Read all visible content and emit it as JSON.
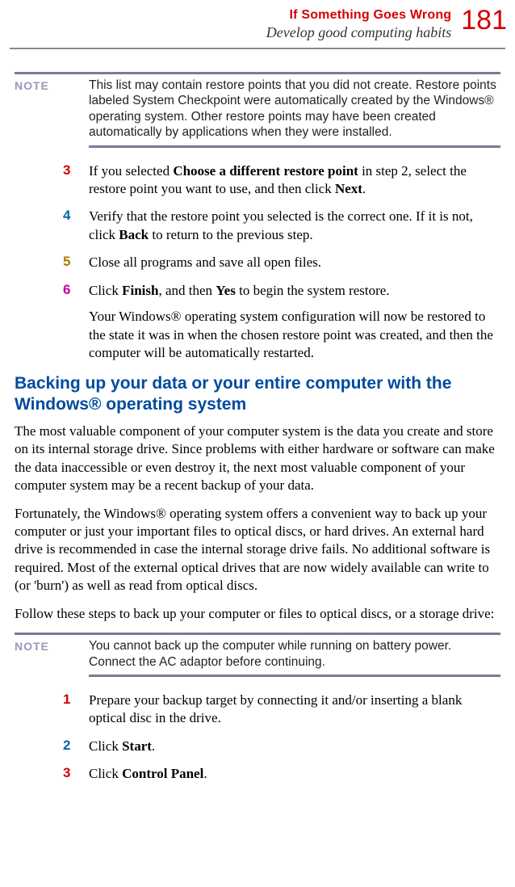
{
  "header": {
    "title": "If Something Goes Wrong",
    "subtitle": "Develop good computing habits",
    "page_number": "181"
  },
  "note1": {
    "label": "NOTE",
    "text": "This list may contain restore points that you did not create. Restore points labeled System Checkpoint were automatically created by the Windows® operating system. Other restore points may have been created automatically by applications when they were installed."
  },
  "steps_a": {
    "s3": {
      "num": "3",
      "pre": "If you selected ",
      "bold1": "Choose a different restore point",
      "mid": " in step 2, select the restore point you want to use, and then click ",
      "bold2": "Next",
      "post": "."
    },
    "s4": {
      "num": "4",
      "pre": "Verify that the restore point you selected is the correct one. If it is not, click ",
      "bold1": "Back",
      "post": " to return to the previous step."
    },
    "s5": {
      "num": "5",
      "text": "Close all programs and save all open files."
    },
    "s6": {
      "num": "6",
      "pre": "Click ",
      "bold1": "Finish",
      "mid": ", and then ",
      "bold2": "Yes",
      "post": " to begin the system restore.",
      "para2": "Your Windows® operating system configuration will now be restored to the state it was in when the chosen restore point was created, and then the computer will be automatically restarted."
    }
  },
  "section": {
    "heading": "Backing up your data or your entire computer with the Windows® operating system",
    "p1": "The most valuable component of your computer system is the data you create and store on its internal storage drive. Since problems with either hardware or software can make the data inaccessible or even destroy it, the next most valuable component of your computer system may be a recent backup of your data.",
    "p2": "Fortunately, the Windows® operating system offers a convenient way to back up your computer or just your important files to optical discs, or hard drives. An external hard drive is recommended in case the internal storage drive fails. No additional software is required. Most of the external optical drives that are now widely available can write to (or 'burn') as well as read from optical discs.",
    "p3": "Follow these steps to back up your computer or files to optical discs, or a storage drive:"
  },
  "note2": {
    "label": "NOTE",
    "text": "You cannot back up the computer while running on battery power. Connect the AC adaptor before continuing."
  },
  "steps_b": {
    "s1": {
      "num": "1",
      "text": "Prepare your backup target by connecting it and/or inserting a blank optical disc in the drive."
    },
    "s2": {
      "num": "2",
      "pre": "Click ",
      "bold1": "Start",
      "post": "."
    },
    "s3": {
      "num": "3",
      "pre": "Click ",
      "bold1": "Control Panel",
      "post": "."
    }
  }
}
